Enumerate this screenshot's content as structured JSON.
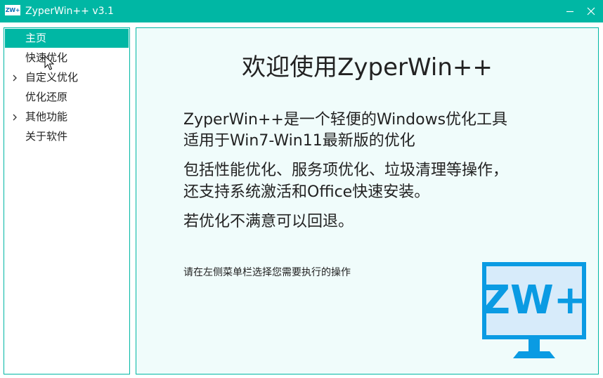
{
  "window": {
    "title": "ZyperWin++ v3.1",
    "app_icon_text": "ZW+",
    "accent_color": "#00b7a4"
  },
  "sidebar": {
    "items": [
      {
        "label": "主页",
        "selected": true,
        "expandable": false
      },
      {
        "label": "快速优化",
        "selected": false,
        "expandable": false
      },
      {
        "label": "自定义优化",
        "selected": false,
        "expandable": true
      },
      {
        "label": "优化还原",
        "selected": false,
        "expandable": false
      },
      {
        "label": "其他功能",
        "selected": false,
        "expandable": true
      },
      {
        "label": "关于软件",
        "selected": false,
        "expandable": false
      }
    ]
  },
  "main": {
    "heading": "欢迎使用ZyperWin++",
    "lines": [
      "ZyperWin++是一个轻便的Windows优化工具",
      "适用于Win7-Win11最新版的优化",
      "包括性能优化、服务项优化、垃圾清理等操作，",
      "还支持系统激活和Office快速安装。",
      "若优化不满意可以回退。"
    ],
    "hint": "请在左侧菜单栏选择您需要执行的操作",
    "logo_text": "ZW+",
    "logo_color": "#0a9be3",
    "logo_fill": "#d7ebfa"
  }
}
